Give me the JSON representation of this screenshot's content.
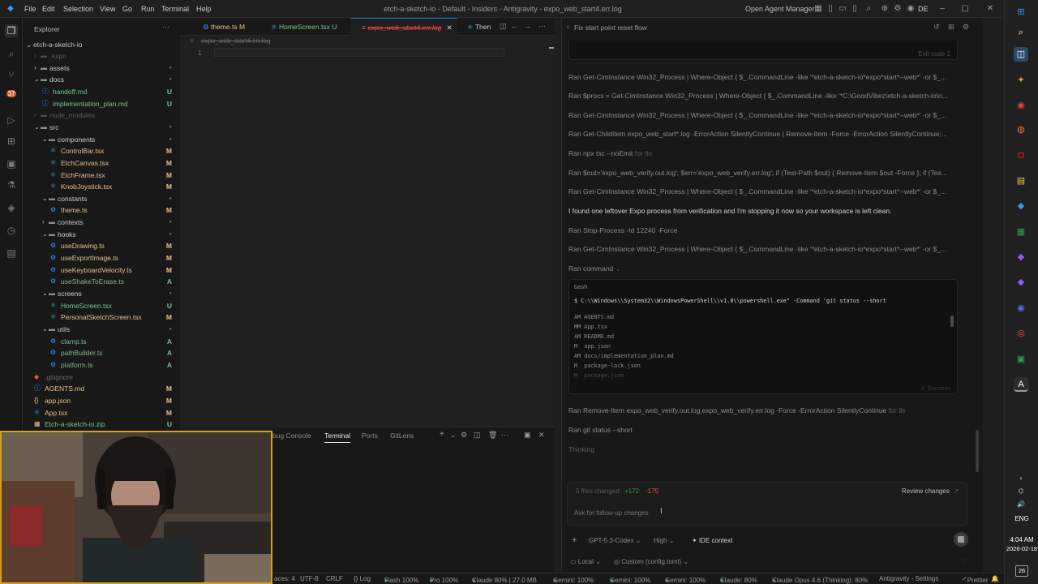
{
  "titlebar": {
    "menus": [
      "File",
      "Edit",
      "Selection",
      "View",
      "Go",
      "Run",
      "Terminal",
      "Help"
    ],
    "window_title": "etch-a-sketch-io - Default - Insiders - Antigravity - expo_web_start4.err.log",
    "agent_manager": "Open Agent Manager",
    "account": "DE"
  },
  "explorer": {
    "header": "Explorer",
    "root": "etch-a-sketch-io",
    "items": [
      {
        "label": ".expo",
        "status": "",
        "indent": 1,
        "kind": "folder-dim"
      },
      {
        "label": "assets",
        "status": "",
        "indent": 1,
        "kind": "folder"
      },
      {
        "label": "docs",
        "status": "",
        "indent": 1,
        "kind": "folder-open"
      },
      {
        "label": "handoff.md",
        "status": "U",
        "indent": 2,
        "kind": "md"
      },
      {
        "label": "implementation_plan.md",
        "status": "U",
        "indent": 2,
        "kind": "md"
      },
      {
        "label": "node_modules",
        "status": "",
        "indent": 1,
        "kind": "folder-dim"
      },
      {
        "label": "src",
        "status": "",
        "indent": 1,
        "kind": "folder-open"
      },
      {
        "label": "components",
        "status": "",
        "indent": 2,
        "kind": "folder-open"
      },
      {
        "label": "ControlBar.tsx",
        "status": "M",
        "indent": 3,
        "kind": "tsx"
      },
      {
        "label": "EtchCanvas.tsx",
        "status": "M",
        "indent": 3,
        "kind": "tsx"
      },
      {
        "label": "EtchFrame.tsx",
        "status": "M",
        "indent": 3,
        "kind": "tsx"
      },
      {
        "label": "KnobJoystick.tsx",
        "status": "M",
        "indent": 3,
        "kind": "tsx"
      },
      {
        "label": "constants",
        "status": "",
        "indent": 2,
        "kind": "folder-open"
      },
      {
        "label": "theme.ts",
        "status": "M",
        "indent": 3,
        "kind": "ts"
      },
      {
        "label": "contexts",
        "status": "",
        "indent": 2,
        "kind": "folder"
      },
      {
        "label": "hooks",
        "status": "",
        "indent": 2,
        "kind": "folder-open"
      },
      {
        "label": "useDrawing.ts",
        "status": "M",
        "indent": 3,
        "kind": "ts"
      },
      {
        "label": "useExportImage.ts",
        "status": "M",
        "indent": 3,
        "kind": "ts"
      },
      {
        "label": "useKeyboardVelocity.ts",
        "status": "M",
        "indent": 3,
        "kind": "ts"
      },
      {
        "label": "useShakeToErase.ts",
        "status": "A",
        "indent": 3,
        "kind": "ts"
      },
      {
        "label": "screens",
        "status": "",
        "indent": 2,
        "kind": "folder-open"
      },
      {
        "label": "HomeScreen.tsx",
        "status": "U",
        "indent": 3,
        "kind": "tsx"
      },
      {
        "label": "PersonalSketchScreen.tsx",
        "status": "M",
        "indent": 3,
        "kind": "tsx"
      },
      {
        "label": "utils",
        "status": "",
        "indent": 2,
        "kind": "folder-open"
      },
      {
        "label": "clamp.ts",
        "status": "A",
        "indent": 3,
        "kind": "ts"
      },
      {
        "label": "pathBuilder.ts",
        "status": "A",
        "indent": 3,
        "kind": "ts"
      },
      {
        "label": "platform.ts",
        "status": "A",
        "indent": 3,
        "kind": "ts"
      },
      {
        "label": ".gitignore",
        "status": "",
        "indent": 1,
        "kind": "git"
      },
      {
        "label": "AGENTS.md",
        "status": "M",
        "indent": 1,
        "kind": "md"
      },
      {
        "label": "app.json",
        "status": "M",
        "indent": 1,
        "kind": "json"
      },
      {
        "label": "App.tsx",
        "status": "M",
        "indent": 1,
        "kind": "tsx"
      },
      {
        "label": "Etch-a-sketch-io.zip",
        "status": "U",
        "indent": 1,
        "kind": "zip"
      }
    ]
  },
  "editor": {
    "tabs": [
      {
        "label": "theme.ts",
        "status": "M",
        "active": false
      },
      {
        "label": "HomeScreen.tsx",
        "status": "U",
        "active": false
      },
      {
        "label": "expo_web_start4.err.log",
        "status": "",
        "active": true
      },
      {
        "label": "Then",
        "status": "",
        "active": false
      }
    ],
    "breadcrumb": "expo_web_start4.err.log",
    "line_number": "1"
  },
  "panel": {
    "tabs": [
      "bug Console",
      "Terminal",
      "Ports",
      "GitLens"
    ],
    "active_tab": "Terminal"
  },
  "agent": {
    "title": "Fix start point reset flow",
    "exit_code": "Exit code 1",
    "lines": [
      "Ran Get-CimInstance Win32_Process | Where-Object { $_.CommandLine -like '*etch-a-sketch-io*expo*start*--web*' -or $_...",
      "Ran $procs = Get-CimInstance Win32_Process | Where-Object { $_.CommandLine -like '*C:\\GoodVibez\\etch-a-sketch-io\\n...",
      "Ran Get-CimInstance Win32_Process | Where-Object { $_.CommandLine -like '*etch-a-sketch-io*expo*start*--web*' -or $_...",
      "Ran Get-ChildItem expo_web_start*.log -ErrorAction SilentlyContinue | Remove-Item -Force -ErrorAction SilentlyContinue;...",
      "Ran npx tsc --noEmit",
      "Ran $out='expo_web_verify.out.log'; $err='expo_web_verify.err.log'; if (Test-Path $out) { Remove-Item $out -Force }; if (Tes...",
      "Ran Get-CimInstance Win32_Process | Where-Object { $_.CommandLine -like '*etch-a-sketch-io*expo*start*--web*' -or $_..."
    ],
    "npx_suffix": "for 8s",
    "message": "I found one leftover Expo process from verification and I'm stopping it now so your workspace is left clean.",
    "lines2": [
      "Ran Stop-Process -Id 12240 -Force",
      "Ran Get-CimInstance Win32_Process | Where-Object { $_.CommandLine -like '*etch-a-sketch-io*expo*start*--web*' -or $_..."
    ],
    "ran_command": "Ran command",
    "code_lang": "bash",
    "code_cmd": "$ C:\\\\Windows\\\\System32\\\\WindowsPowerShell\\\\v1.0\\\\powershell.exe\" -Command 'git status --short",
    "code_output": [
      "AM AGENTS.md",
      "MM App.tsx",
      "AM README.md",
      "M  app.json",
      "AM docs/implementation_plan.md",
      "M  package-lock.json",
      "M  package.json"
    ],
    "code_status": "Success",
    "lines3": [
      "Ran Remove-Item expo_web_verify.out.log,expo_web_verify.err.log -Force -ErrorAction SilentlyContinue",
      "Ran git status --short"
    ],
    "remove_suffix": "for 8s",
    "thinking": "Thinking",
    "files_changed": "5 files changed",
    "added": "+172",
    "removed": "-175",
    "review": "Review changes",
    "input_placeholder": "Ask for follow-up changes",
    "model": "GPT-5.3-Codex",
    "effort": "High",
    "ide_context": "IDE context",
    "local": "Local",
    "config": "Custom (config.toml)"
  },
  "statusbar": {
    "items": [
      "aces: 4",
      "UTF-8",
      "CRLF",
      "{} Log",
      "Flash 100%",
      "Pro 100%",
      "Claude 80% | 27.0 MB",
      "Gemini: 100%",
      "Gemini: 100%",
      "Gemini: 100%",
      "Claude: 80%",
      "Claude Opus 4.6 (Thinking): 80%",
      "Antigravity - Settings",
      "Prettier"
    ]
  },
  "taskbar": {
    "lang": "ENG",
    "time": "4:04 AM",
    "date": "2026-02-18",
    "notif": "26"
  },
  "colors": {
    "modified": "#e2c08d",
    "untracked": "#73c991",
    "added": "#81b88b",
    "accent": "#0078d4",
    "green": "#2ea043",
    "red": "#f85149"
  }
}
